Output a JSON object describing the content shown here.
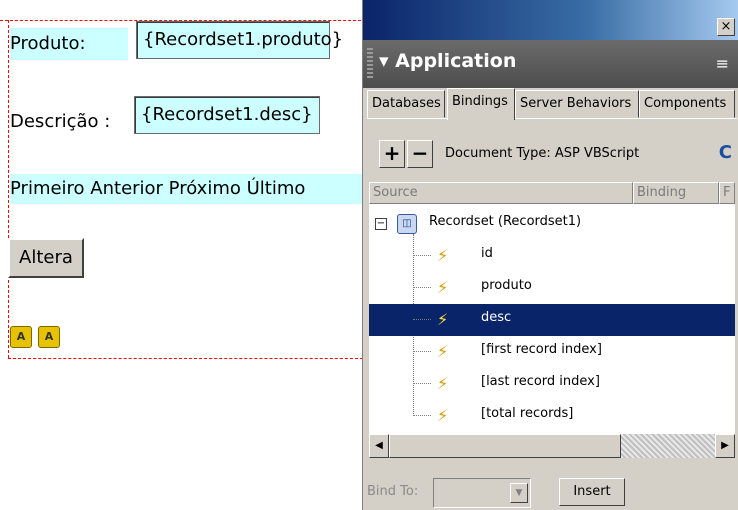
{
  "design": {
    "produto_label": "Produto:",
    "produto_field": "{Recordset1.produto}",
    "desc_label": "Descrição :",
    "desc_field": "{Recordset1.desc}",
    "nav_links": "Primeiro Anterior Próximo Último",
    "altera_button": "Altera",
    "asp_icon_glyph": "A"
  },
  "panel": {
    "close_glyph": "×",
    "title": "▾ Application",
    "tabs": [
      "Databases",
      "Bindings",
      "Server Behaviors",
      "Components"
    ],
    "active_tab": "Bindings",
    "toolbar": {
      "add": "+",
      "remove": "−",
      "document_type": "Document Type: ASP VBScript",
      "refresh_glyph": "C"
    },
    "columns": [
      "Source",
      "Binding",
      "F"
    ],
    "recordset_label": "Recordset (Recordset1)",
    "fields": [
      "id",
      "produto",
      "desc",
      "[first record index]",
      "[last record index]",
      "[total records]"
    ],
    "selected_field": "desc",
    "bind_to_label": "Bind To:",
    "insert_button": "Insert"
  }
}
